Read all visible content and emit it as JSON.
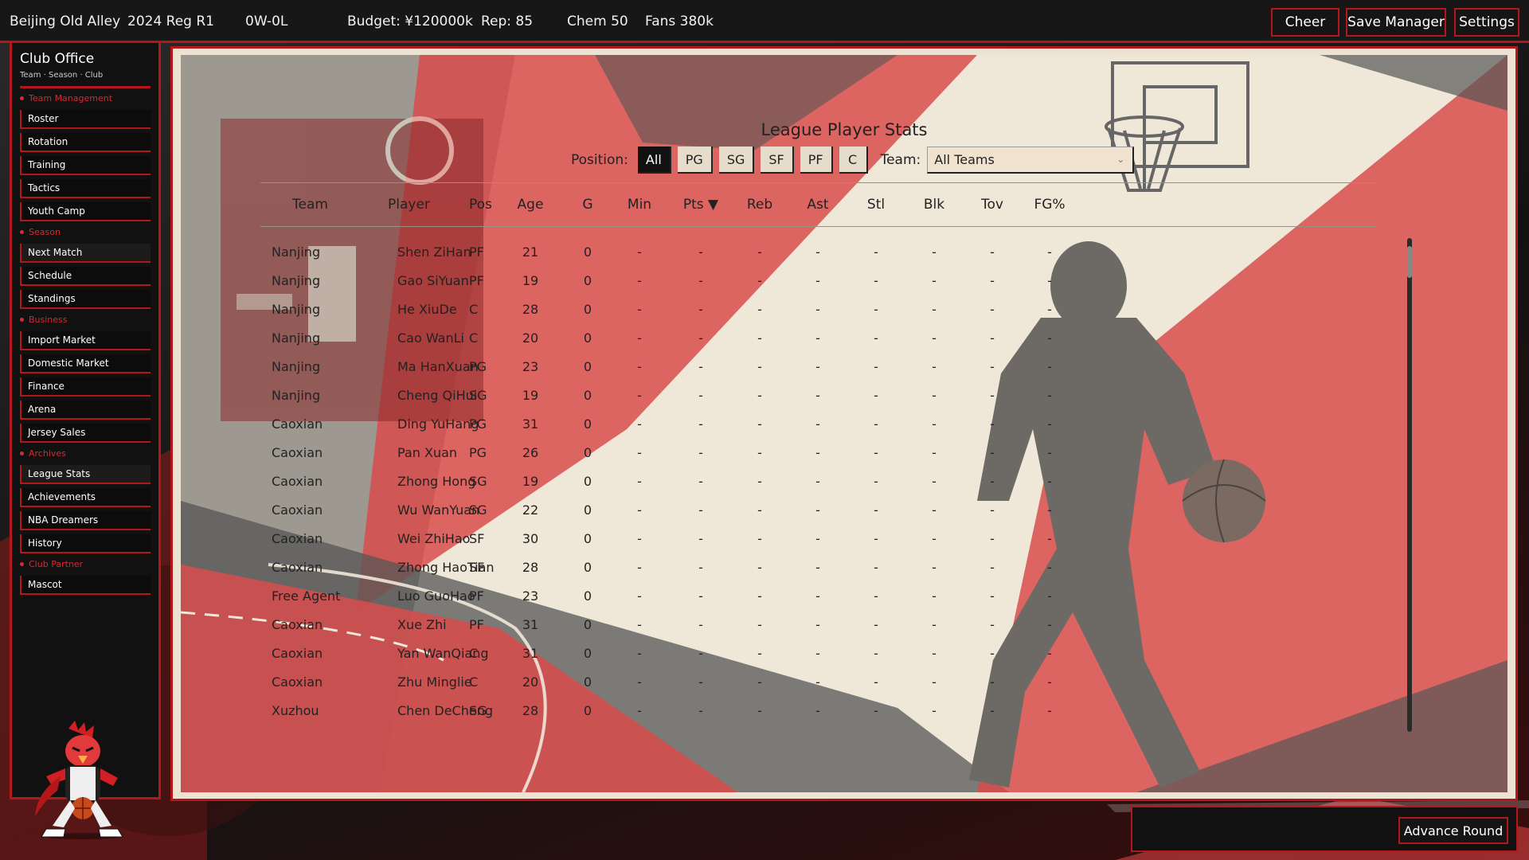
{
  "topbar": {
    "club": "Beijing Old Alley",
    "round": "2024 Reg R1",
    "record": "0W-0L",
    "budget": "Budget: ¥120000k",
    "rep": "Rep: 85",
    "chem": "Chem 50",
    "fans": "Fans 380k",
    "buttons": {
      "cheer": "Cheer",
      "save": "Save Manager",
      "settings": "Settings"
    }
  },
  "sidebar": {
    "title": "Club Office",
    "subtitle": "Team · Season · Club",
    "sections": [
      {
        "label": "Team Management",
        "items": [
          "Roster",
          "Rotation",
          "Training",
          "Tactics",
          "Youth Camp"
        ]
      },
      {
        "label": "Season",
        "items": [
          "Next Match",
          "Schedule",
          "Standings"
        ]
      },
      {
        "label": "Business",
        "items": [
          "Import Market",
          "Domestic Market",
          "Finance",
          "Arena",
          "Jersey Sales"
        ]
      },
      {
        "label": "Archives",
        "items": [
          "League Stats",
          "Achievements",
          "NBA Dreamers",
          "History"
        ]
      },
      {
        "label": "Club Partner",
        "items": [
          "Mascot"
        ]
      }
    ]
  },
  "stats": {
    "title": "League Player Stats",
    "position_label": "Position:",
    "positions": [
      "All",
      "PG",
      "SG",
      "SF",
      "PF",
      "C"
    ],
    "active_position": "All",
    "team_label": "Team:",
    "team_value": "All Teams",
    "columns": [
      "Team",
      "Player",
      "Pos",
      "Age",
      "G",
      "Min",
      "Pts ▼",
      "Reb",
      "Ast",
      "Stl",
      "Blk",
      "Tov",
      "FG%"
    ],
    "rows": [
      [
        "Nanjing",
        "Shen ZiHan",
        "PF",
        "21",
        "0",
        "-",
        "-",
        "-",
        "-",
        "-",
        "-",
        "-",
        "-"
      ],
      [
        "Nanjing",
        "Gao SiYuan",
        "PF",
        "19",
        "0",
        "-",
        "-",
        "-",
        "-",
        "-",
        "-",
        "-",
        "-"
      ],
      [
        "Nanjing",
        "He XiuDe",
        "C",
        "28",
        "0",
        "-",
        "-",
        "-",
        "-",
        "-",
        "-",
        "-",
        "-"
      ],
      [
        "Nanjing",
        "Cao WanLi",
        "C",
        "20",
        "0",
        "-",
        "-",
        "-",
        "-",
        "-",
        "-",
        "-",
        "-"
      ],
      [
        "Nanjing",
        "Ma HanXuan",
        "PG",
        "23",
        "0",
        "-",
        "-",
        "-",
        "-",
        "-",
        "-",
        "-",
        "-"
      ],
      [
        "Nanjing",
        "Cheng QiHui",
        "SG",
        "19",
        "0",
        "-",
        "-",
        "-",
        "-",
        "-",
        "-",
        "-",
        "-"
      ],
      [
        "Caoxian",
        "Ding YuHang",
        "PG",
        "31",
        "0",
        "-",
        "-",
        "-",
        "-",
        "-",
        "-",
        "-",
        "-"
      ],
      [
        "Caoxian",
        "Pan Xuan",
        "PG",
        "26",
        "0",
        "-",
        "-",
        "-",
        "-",
        "-",
        "-",
        "-",
        "-"
      ],
      [
        "Caoxian",
        "Zhong Hong",
        "SG",
        "19",
        "0",
        "-",
        "-",
        "-",
        "-",
        "-",
        "-",
        "-",
        "-"
      ],
      [
        "Caoxian",
        "Wu WanYuan",
        "SG",
        "22",
        "0",
        "-",
        "-",
        "-",
        "-",
        "-",
        "-",
        "-",
        "-"
      ],
      [
        "Caoxian",
        "Wei ZhiHao",
        "SF",
        "30",
        "0",
        "-",
        "-",
        "-",
        "-",
        "-",
        "-",
        "-",
        "-"
      ],
      [
        "Caoxian",
        "Zhong HaoTian",
        "SF",
        "28",
        "0",
        "-",
        "-",
        "-",
        "-",
        "-",
        "-",
        "-",
        "-"
      ],
      [
        "Free Agent",
        "Luo GuoHao",
        "PF",
        "23",
        "0",
        "-",
        "-",
        "-",
        "-",
        "-",
        "-",
        "-",
        "-"
      ],
      [
        "Caoxian",
        "Xue Zhi",
        "PF",
        "31",
        "0",
        "-",
        "-",
        "-",
        "-",
        "-",
        "-",
        "-",
        "-"
      ],
      [
        "Caoxian",
        "Yan WanQiang",
        "C",
        "31",
        "0",
        "-",
        "-",
        "-",
        "-",
        "-",
        "-",
        "-",
        "-"
      ],
      [
        "Caoxian",
        "Zhu Minglie",
        "C",
        "20",
        "0",
        "-",
        "-",
        "-",
        "-",
        "-",
        "-",
        "-",
        "-"
      ],
      [
        "Xuzhou",
        "Chen DeCheng",
        "SG",
        "28",
        "0",
        "-",
        "-",
        "-",
        "-",
        "-",
        "-",
        "-",
        "-"
      ]
    ]
  },
  "footer": {
    "advance": "Advance Round"
  },
  "colors": {
    "accent": "#b3161b",
    "panel": "#efe7d8",
    "dark": "#111111"
  }
}
